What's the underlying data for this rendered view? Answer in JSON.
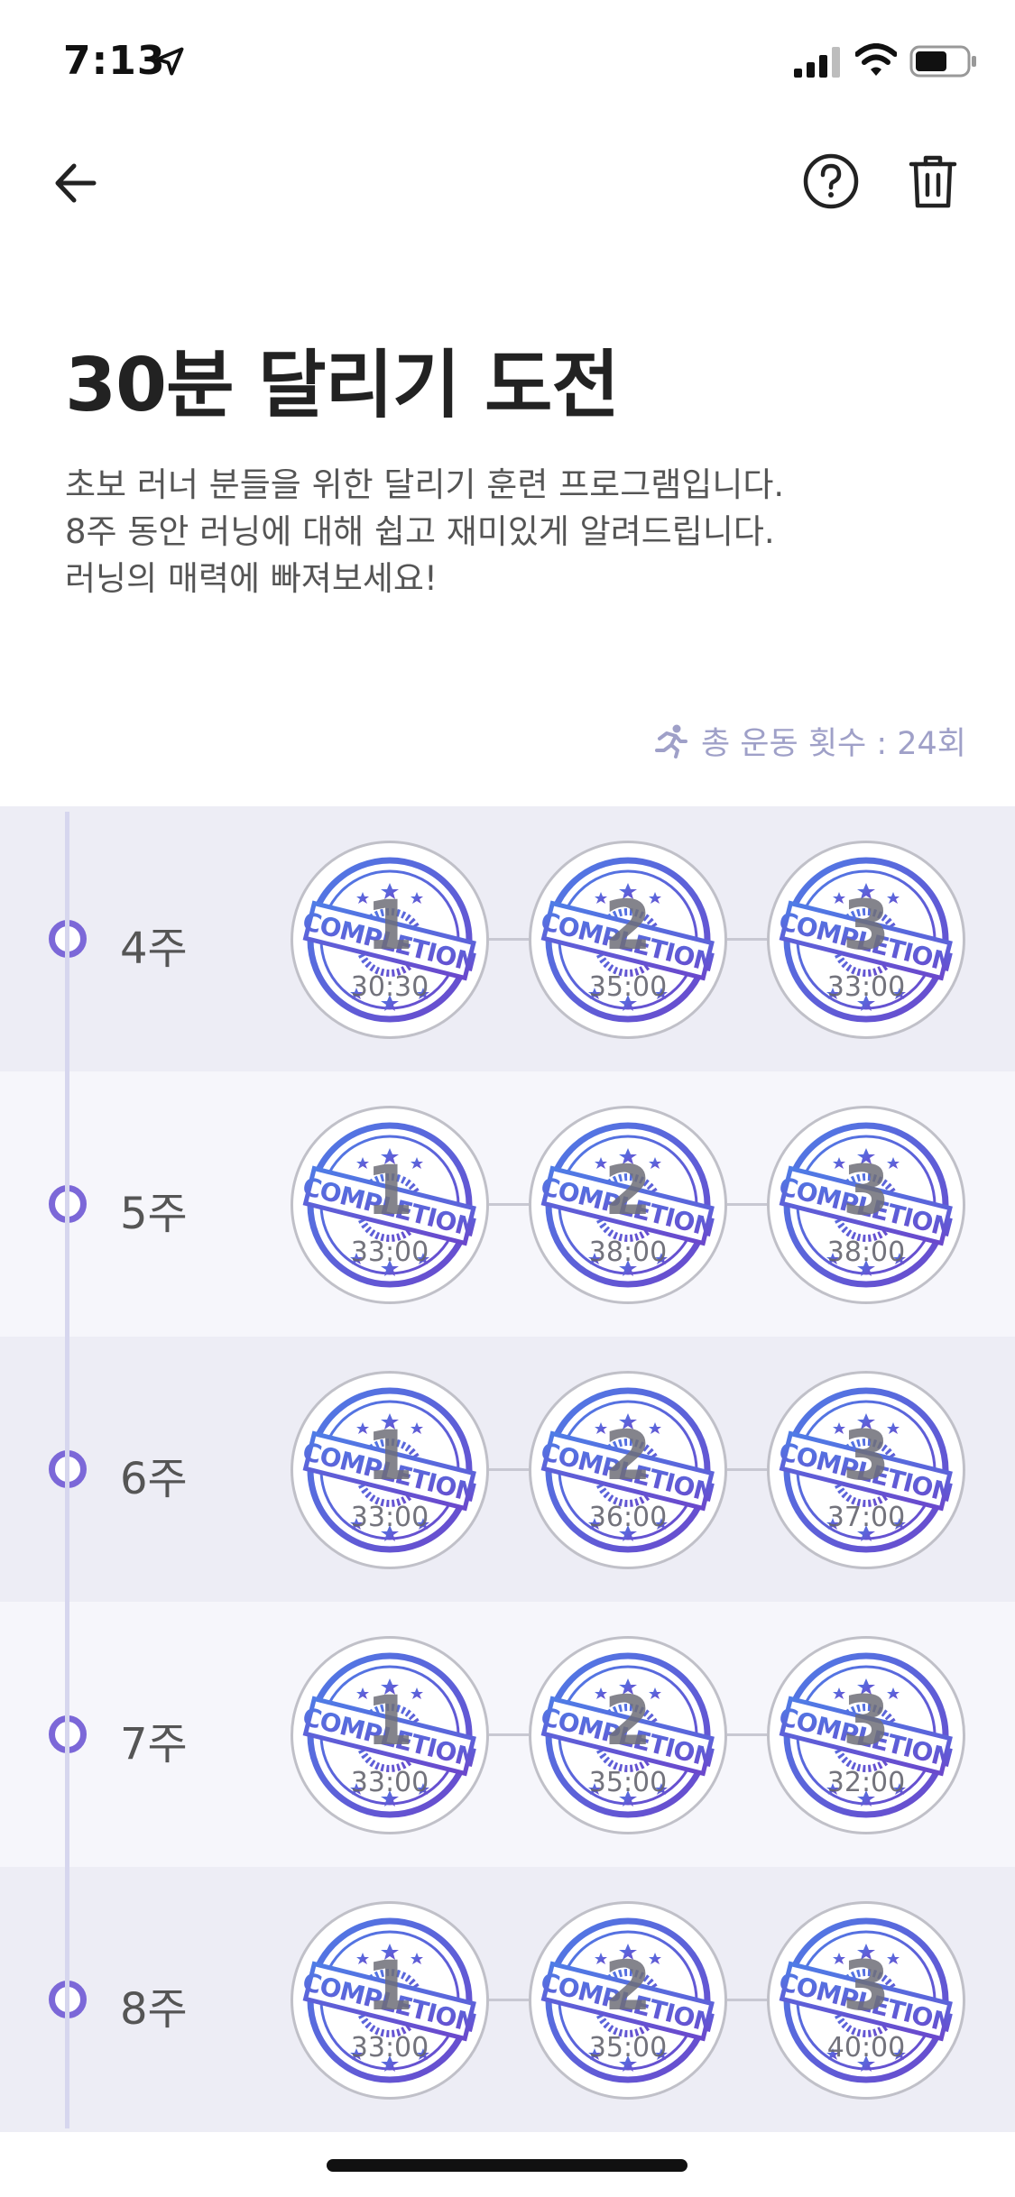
{
  "status_bar": {
    "time": "7:13"
  },
  "page": {
    "title": "30분 달리기 도전",
    "description": [
      "초보 러너 분들을 위한 달리기 훈련 프로그램입니다.",
      "8주 동안 러닝에 대해 쉽고 재미있게 알려드립니다.",
      "러닝의 매력에 빠져보세요!"
    ],
    "total_count": "총 운동 횟수 : 24회"
  },
  "stamp_text": "COMPLETION",
  "colors": {
    "accent": "#7c68d8",
    "stamp_blue": "#4e6fe0",
    "stamp_purple": "#6a4fd0",
    "muted_label": "#9fa0c8",
    "row_dark": "#ededf5",
    "row_light": "#f6f6fb"
  },
  "icons": {
    "back": "arrow-left-icon",
    "help": "question-circle-icon",
    "trash": "trash-icon",
    "run": "running-person-icon"
  },
  "weeks": [
    {
      "label": "4주",
      "sessions": [
        {
          "number": "1",
          "time": "30:30"
        },
        {
          "number": "2",
          "time": "35:00"
        },
        {
          "number": "3",
          "time": "33:00"
        }
      ]
    },
    {
      "label": "5주",
      "sessions": [
        {
          "number": "1",
          "time": "33:00"
        },
        {
          "number": "2",
          "time": "38:00"
        },
        {
          "number": "3",
          "time": "38:00"
        }
      ]
    },
    {
      "label": "6주",
      "sessions": [
        {
          "number": "1",
          "time": "33:00"
        },
        {
          "number": "2",
          "time": "36:00"
        },
        {
          "number": "3",
          "time": "37:00"
        }
      ]
    },
    {
      "label": "7주",
      "sessions": [
        {
          "number": "1",
          "time": "33:00"
        },
        {
          "number": "2",
          "time": "35:00"
        },
        {
          "number": "3",
          "time": "32:00"
        }
      ]
    },
    {
      "label": "8주",
      "sessions": [
        {
          "number": "1",
          "time": "33:00"
        },
        {
          "number": "2",
          "time": "35:00"
        },
        {
          "number": "3",
          "time": "40:00"
        }
      ]
    }
  ]
}
